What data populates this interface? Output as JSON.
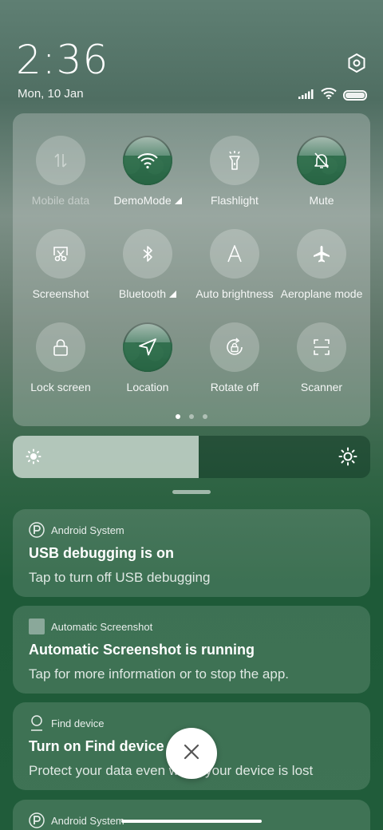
{
  "status": {
    "time": "2:36",
    "date": "Mon, 10 Jan"
  },
  "tiles": [
    {
      "label": "Mobile data",
      "icon": "mobile-data-icon",
      "active": false,
      "disabled": true
    },
    {
      "label": "DemoMode",
      "icon": "wifi-icon",
      "active": true
    },
    {
      "label": "Flashlight",
      "icon": "flashlight-icon",
      "active": false
    },
    {
      "label": "Mute",
      "icon": "mute-icon",
      "active": true
    },
    {
      "label": "Screenshot",
      "icon": "screenshot-icon",
      "active": false
    },
    {
      "label": "Bluetooth",
      "icon": "bluetooth-icon",
      "active": false
    },
    {
      "label": "Auto brightness",
      "icon": "auto-brightness-icon",
      "active": false
    },
    {
      "label": "Aeroplane mode",
      "icon": "aeroplane-icon",
      "active": false
    },
    {
      "label": "Lock screen",
      "icon": "lock-icon",
      "active": false
    },
    {
      "label": "Location",
      "icon": "location-icon",
      "active": true
    },
    {
      "label": "Rotate off",
      "icon": "rotate-icon",
      "active": false
    },
    {
      "label": "Scanner",
      "icon": "scanner-icon",
      "active": false
    }
  ],
  "pager": {
    "pages": 3,
    "current": 1
  },
  "brightness": {
    "level": 0.52
  },
  "notifications": [
    {
      "app": "Android System",
      "title": "USB debugging is on",
      "body": "Tap to turn off USB debugging",
      "icon": "android-system-icon"
    },
    {
      "app": "Automatic Screenshot",
      "title": "Automatic Screenshot is running",
      "body": "Tap for more information or to stop the app.",
      "icon": "app-square-icon"
    },
    {
      "app": "Find device",
      "title": "Turn on Find device",
      "body": "Protect your data even when your device is lost",
      "icon": "find-device-icon"
    },
    {
      "app": "Android System",
      "icon": "android-system-icon"
    }
  ]
}
